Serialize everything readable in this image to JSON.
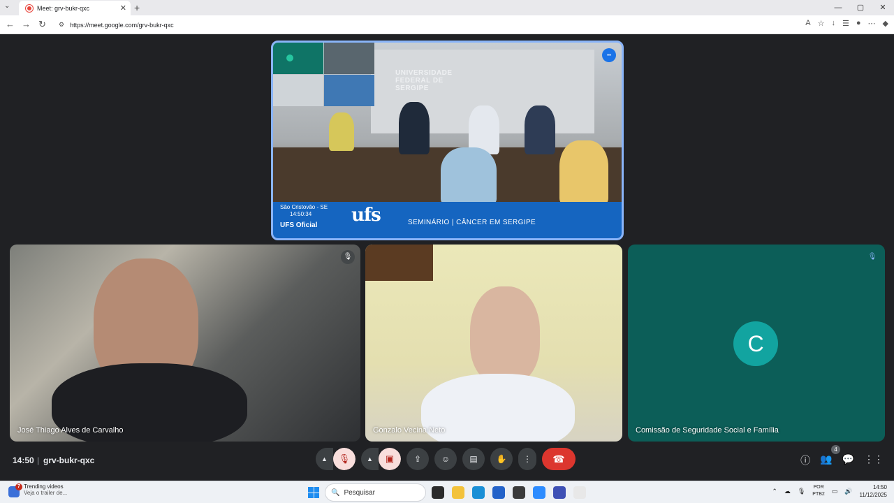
{
  "browser": {
    "tab_title": "Meet: grv-bukr-qxc",
    "url": "https://meet.google.com/grv-bukr-qxc",
    "window_controls": [
      "—",
      "▢",
      "✕"
    ]
  },
  "featured": {
    "wall_text": [
      "UNIVERSIDADE",
      "FEDERAL DE",
      "SERGIPE"
    ],
    "location": "São Cristovão - SE",
    "time": "14:50:34",
    "channel": "UFS Oficial",
    "logo": "ufs",
    "seminar": "SEMINÁRIO |  CÂNCER  EM  SERGIPE"
  },
  "participants": [
    {
      "name": "José Thiago Alves de Carvalho",
      "muted": true
    },
    {
      "name": "Gonzalo Vecina Neto",
      "muted": false
    },
    {
      "name": "Comissão de Seguridade Social e Família",
      "muted": true,
      "initial": "C"
    }
  ],
  "bottom_bar": {
    "time": "14:50",
    "meeting_code": "grv-bukr-qxc",
    "participant_count": "4"
  },
  "taskbar": {
    "widget_title": "Trending videos",
    "widget_subtitle": "Veja o trailer de...",
    "widget_badge": "7",
    "search_placeholder": "Pesquisar",
    "lang_line1": "POR",
    "lang_line2": "PTB2",
    "clock_time": "14:50",
    "clock_date": "11/12/2025"
  },
  "colors": {
    "accent": "#8ab4f8",
    "end_call": "#dc362e",
    "muted_bg": "#f9dedc",
    "avatar_bg": "#12a4a0",
    "meet_bg": "#202124"
  }
}
